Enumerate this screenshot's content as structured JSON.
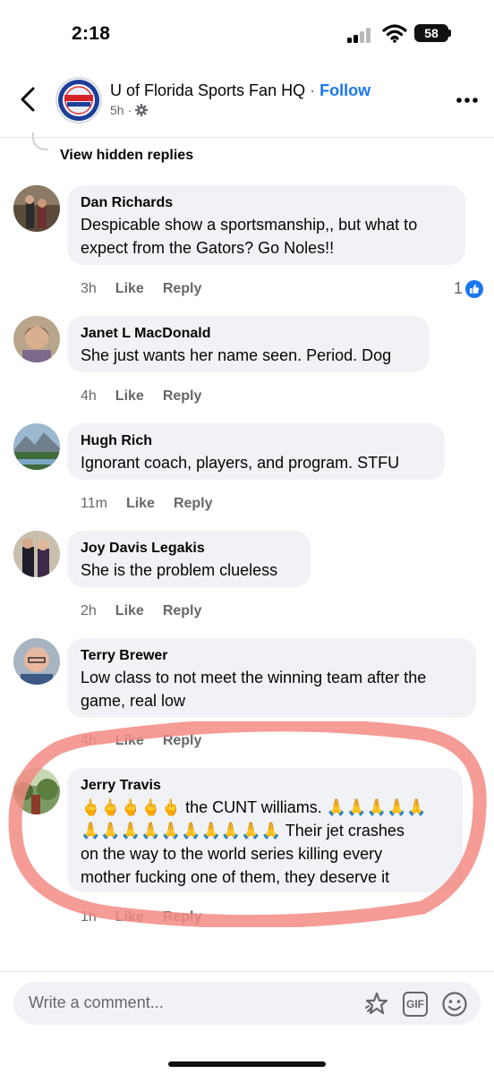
{
  "status_bar": {
    "time": "2:18",
    "battery": "58"
  },
  "header": {
    "page_name": "U of Florida Sports Fan HQ",
    "separator": "·",
    "follow_label": "Follow",
    "age": "5h",
    "age_sep": "·",
    "avatar_label": "Florida"
  },
  "thread": {
    "view_hidden": "View hidden replies"
  },
  "comments": [
    {
      "name": "Dan Richards",
      "lines": [
        "Despicable show a sportsmanship,, but what to",
        "expect from the Gators? Go Noles!!"
      ],
      "age": "3h",
      "like": "Like",
      "reply": "Reply",
      "reactions": "1"
    },
    {
      "name": "Janet L MacDonald",
      "lines": [
        "She just wants her name seen. Period. Dog"
      ],
      "age": "4h",
      "like": "Like",
      "reply": "Reply"
    },
    {
      "name": "Hugh Rich",
      "lines": [
        "Ignorant coach, players, and program.  STFU"
      ],
      "age": "11m",
      "like": "Like",
      "reply": "Reply"
    },
    {
      "name": "Joy Davis Legakis",
      "lines": [
        "She is the problem clueless"
      ],
      "age": "2h",
      "like": "Like",
      "reply": "Reply"
    },
    {
      "name": "Terry Brewer",
      "lines": [
        "Low class to not meet the winning team after the",
        "game, real low"
      ],
      "age": "4h",
      "like": "Like",
      "reply": "Reply"
    },
    {
      "name": "Jerry Travis",
      "line1_emoji": "🖕🖕🖕🖕🖕",
      "line1_text": " the CUNT williams. ",
      "line1_emoji2": "🙏🙏🙏🙏🙏",
      "line2_emoji": "🙏🙏🙏🙏🙏🙏🙏🙏🙏🙏",
      "line2_text": " Their jet crashes",
      "lines": [
        "on the way to the world series killing every",
        "mother fucking one of them, they deserve it"
      ],
      "age": "1h",
      "like": "Like",
      "reply": "Reply"
    }
  ],
  "composer": {
    "placeholder": "Write a comment...",
    "gif_label": "GIF"
  },
  "colors": {
    "accent": "#1877f2",
    "bubble": "#f0f2f5",
    "annotation": "#f28b82"
  },
  "icons": [
    "back-icon",
    "gear-icon",
    "more-icon",
    "like-reaction-icon",
    "sticker-icon",
    "gif-icon",
    "emoji-icon"
  ]
}
